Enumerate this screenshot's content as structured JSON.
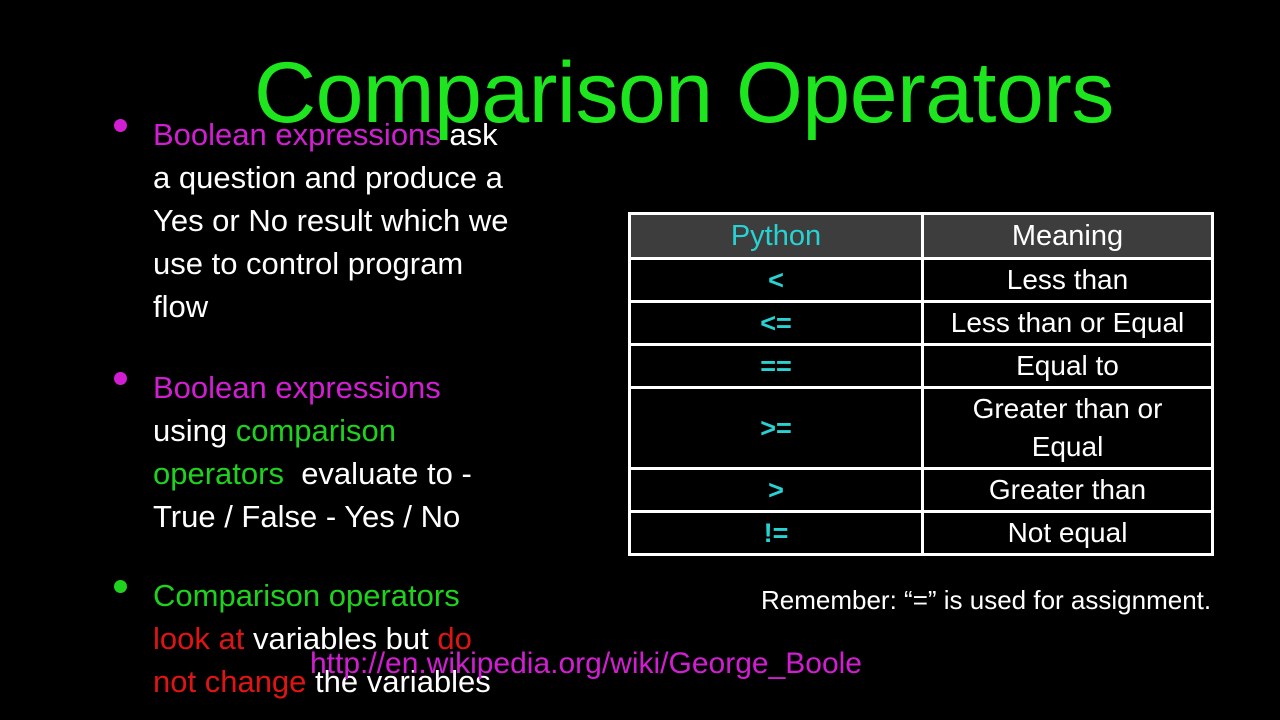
{
  "slide": {
    "title": "Comparison Operators",
    "colors": {
      "background": "#000000",
      "title": "#1ee61e",
      "highlight_magenta": "#d21ed2",
      "highlight_green": "#1ed21e",
      "highlight_red": "#e01414",
      "operator_cyan": "#28d2d2",
      "table_header_bg": "#3d3d3d",
      "body_text": "#ffffff"
    },
    "bullets": [
      {
        "bullet_color": "magenta",
        "lines": [
          [
            {
              "text": "Boolean expressions",
              "color": "magenta"
            },
            {
              "text": " ask",
              "color": "white"
            }
          ],
          [
            {
              "text": "a question and produce a",
              "color": "white"
            }
          ],
          [
            {
              "text": "Yes or No result which we",
              "color": "white"
            }
          ],
          [
            {
              "text": "use to control program",
              "color": "white"
            }
          ],
          [
            {
              "text": "flow",
              "color": "white"
            }
          ]
        ]
      },
      {
        "bullet_color": "magenta",
        "lines": [
          [
            {
              "text": "Boolean expressions",
              "color": "magenta"
            }
          ],
          [
            {
              "text": "using ",
              "color": "white"
            },
            {
              "text": "comparison",
              "color": "green"
            }
          ],
          [
            {
              "text": "operators",
              "color": "green"
            },
            {
              "text": "  evaluate to -",
              "color": "white"
            }
          ],
          [
            {
              "text": "True / False - Yes / No",
              "color": "white"
            }
          ]
        ]
      },
      {
        "bullet_color": "green",
        "lines": [
          [
            {
              "text": "Comparison operators",
              "color": "green"
            }
          ],
          [
            {
              "text": "look at",
              "color": "red"
            },
            {
              "text": " variables but ",
              "color": "white"
            },
            {
              "text": "do",
              "color": "red"
            }
          ],
          [
            {
              "text": "not change",
              "color": "red"
            },
            {
              "text": " the variables",
              "color": "white"
            }
          ]
        ]
      }
    ],
    "table": {
      "headers": [
        "Python",
        "Meaning"
      ],
      "rows": [
        {
          "op": "<",
          "meaning": [
            "Less than"
          ]
        },
        {
          "op": "<=",
          "meaning": [
            "Less than or Equal"
          ]
        },
        {
          "op": "==",
          "meaning": [
            "Equal to"
          ]
        },
        {
          "op": ">=",
          "meaning": [
            "Greater than or",
            "Equal"
          ]
        },
        {
          "op": ">",
          "meaning": [
            "Greater than"
          ]
        },
        {
          "op": "!=",
          "meaning": [
            "Not equal"
          ]
        }
      ]
    },
    "remember_note": "Remember:  “=” is used for assignment.",
    "link_text": "http://en.wikipedia.org/wiki/George_Boole"
  }
}
